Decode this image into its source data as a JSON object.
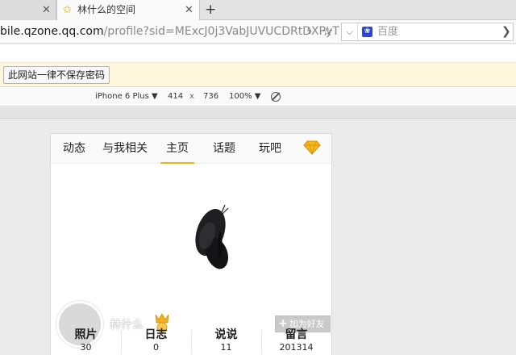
{
  "browser": {
    "tabs": [
      {
        "title": "",
        "active": false
      },
      {
        "title": "林什么的空间",
        "active": true
      }
    ],
    "url_host": "bile.qzone.qq.com",
    "url_rest": "/profile?sid=MExcJ0j3VabJUVUCDRtDXPyT",
    "search": {
      "placeholder": "百度",
      "engine_icon": "paw-icon"
    }
  },
  "password_bar": {
    "never_save_label": "此网站一律不保存密码"
  },
  "device_toolbar": {
    "device": "iPhone 6 Plus ▼",
    "width": "414",
    "times": "x",
    "height": "736",
    "zoom": "100% ▼"
  },
  "mobile": {
    "nav": {
      "items": [
        "动态",
        "与我相关",
        "主页",
        "话题",
        "玩吧"
      ],
      "active_index": 2,
      "accent_color": "#f2b01e"
    },
    "profile": {
      "username": "林什么",
      "add_friend_label": "加为好友"
    },
    "stats": [
      {
        "label": "照片",
        "value": "30"
      },
      {
        "label": "日志",
        "value": "0"
      },
      {
        "label": "说说",
        "value": "11"
      },
      {
        "label": "留言",
        "value": "201314"
      }
    ]
  }
}
